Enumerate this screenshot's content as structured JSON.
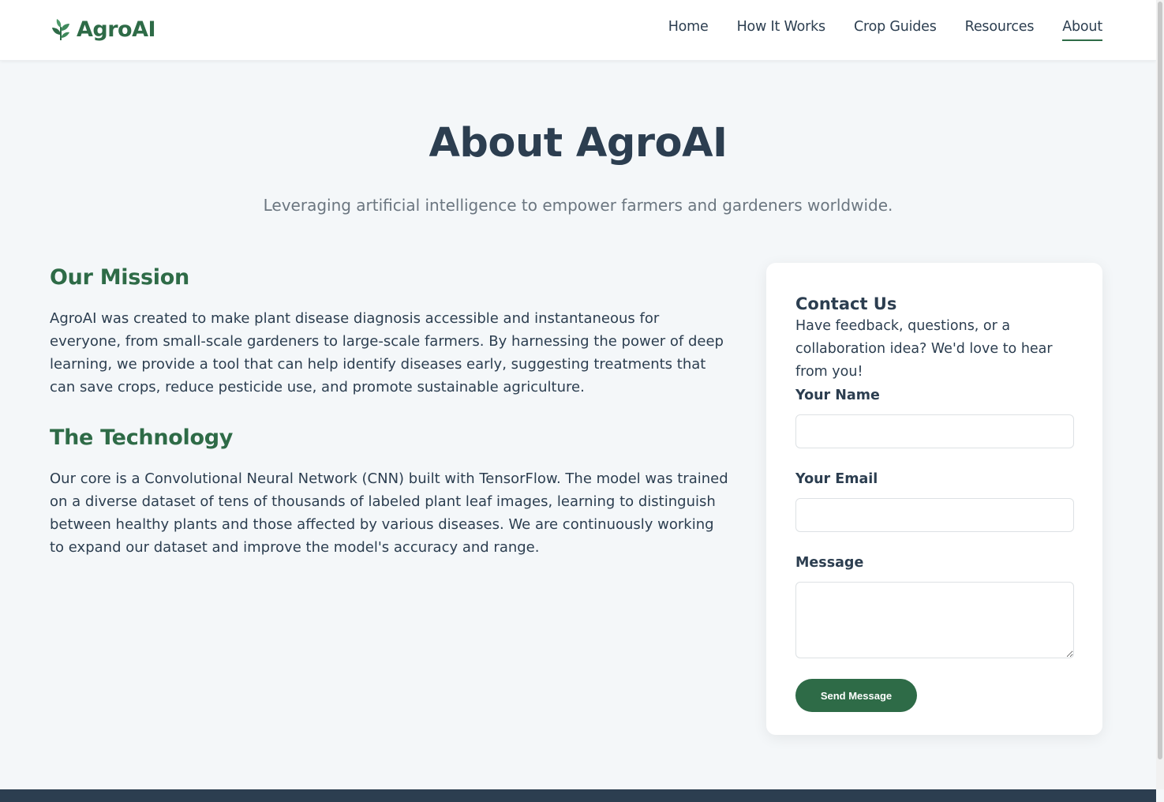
{
  "header": {
    "logo_text": "AgroAI",
    "logo_icon": "leaf-sprig-icon",
    "nav": [
      {
        "label": "Home"
      },
      {
        "label": "How It Works"
      },
      {
        "label": "Crop Guides"
      },
      {
        "label": "Resources"
      },
      {
        "label": "About",
        "active": true
      }
    ]
  },
  "hero": {
    "title": "About AgroAI",
    "subtitle": "Leveraging artificial intelligence to empower farmers and gardeners worldwide."
  },
  "mission": {
    "heading": "Our Mission",
    "text": "AgroAI was created to make plant disease diagnosis accessible and instantaneous for everyone, from small-scale gardeners to large-scale farmers. By harnessing the power of deep learning, we provide a tool that can help identify diseases early, suggesting treatments that can save crops, reduce pesticide use, and promote sustainable agriculture."
  },
  "technology": {
    "heading": "The Technology",
    "text": "Our core is a Convolutional Neural Network (CNN) built with TensorFlow. The model was trained on a diverse dataset of tens of thousands of labeled plant leaf images, learning to distinguish between healthy plants and those affected by various diseases. We are continuously working to expand our dataset and improve the model's accuracy and range."
  },
  "contact": {
    "title": "Contact Us",
    "text": "Have feedback, questions, or a collaboration idea? We'd love to hear from you!",
    "name_label": "Your Name",
    "name_value": "",
    "email_label": "Your Email",
    "email_value": "",
    "message_label": "Message",
    "message_value": "",
    "submit_label": "Send Message"
  },
  "colors": {
    "brand_green": "#2e6b47",
    "text_dark": "#2c3e50",
    "page_bg": "#f4f7f9",
    "footer_bg": "#2c3e50"
  }
}
